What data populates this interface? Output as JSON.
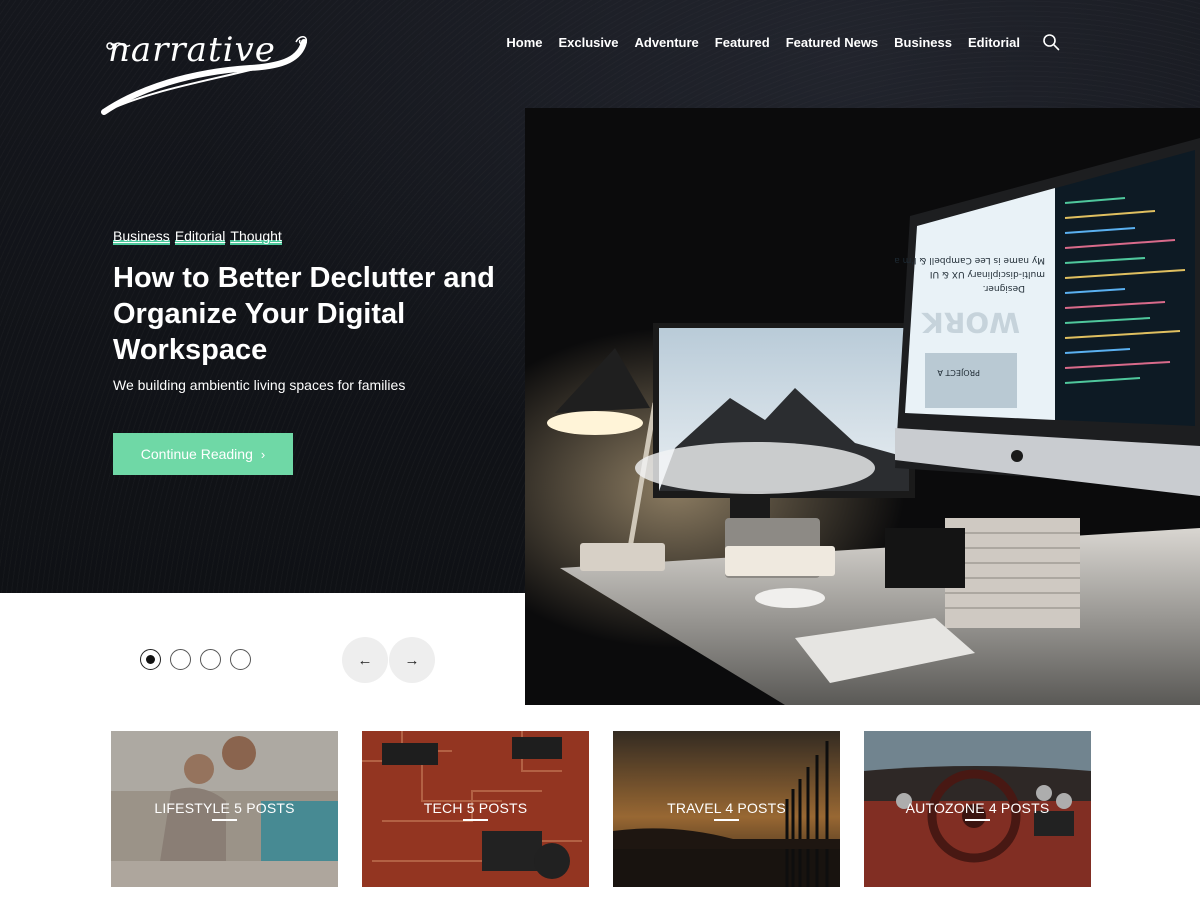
{
  "brand": {
    "logo_text": "narrative"
  },
  "nav": {
    "items": [
      "Home",
      "Exclusive",
      "Adventure",
      "Featured",
      "Featured News",
      "Business",
      "Editorial"
    ]
  },
  "hero": {
    "categories": [
      "Business",
      "Editorial",
      "Thought"
    ],
    "title": "How to Better Declutter and Organize Your Digital Workspace",
    "subtitle": "We building ambientic living spaces for families",
    "cta_label": "Continue Reading",
    "cta_icon": "chevron-right",
    "monitor_text": {
      "line1": "My name is Lee Campbell & I'm a",
      "line2": "multi-disciplinary UX & UI",
      "line3": "Designer.",
      "big": "WORK",
      "project": "PROJECT A"
    }
  },
  "slider": {
    "dots": 4,
    "active_index": 0,
    "prev_icon": "arrow-left",
    "next_icon": "arrow-right"
  },
  "categories": [
    {
      "name": "LIFESTYLE",
      "count": "5 POSTS"
    },
    {
      "name": "TECH",
      "count": "5 POSTS"
    },
    {
      "name": "TRAVEL",
      "count": "4 POSTS"
    },
    {
      "name": "AUTOZONE",
      "count": "4 POSTS"
    }
  ],
  "colors": {
    "hero_bg": "#111318",
    "accent": "#6fd8a6",
    "accent_underline": "#4fc79c",
    "text_light": "#ffffff",
    "arrow_bg": "#eeeeee"
  }
}
